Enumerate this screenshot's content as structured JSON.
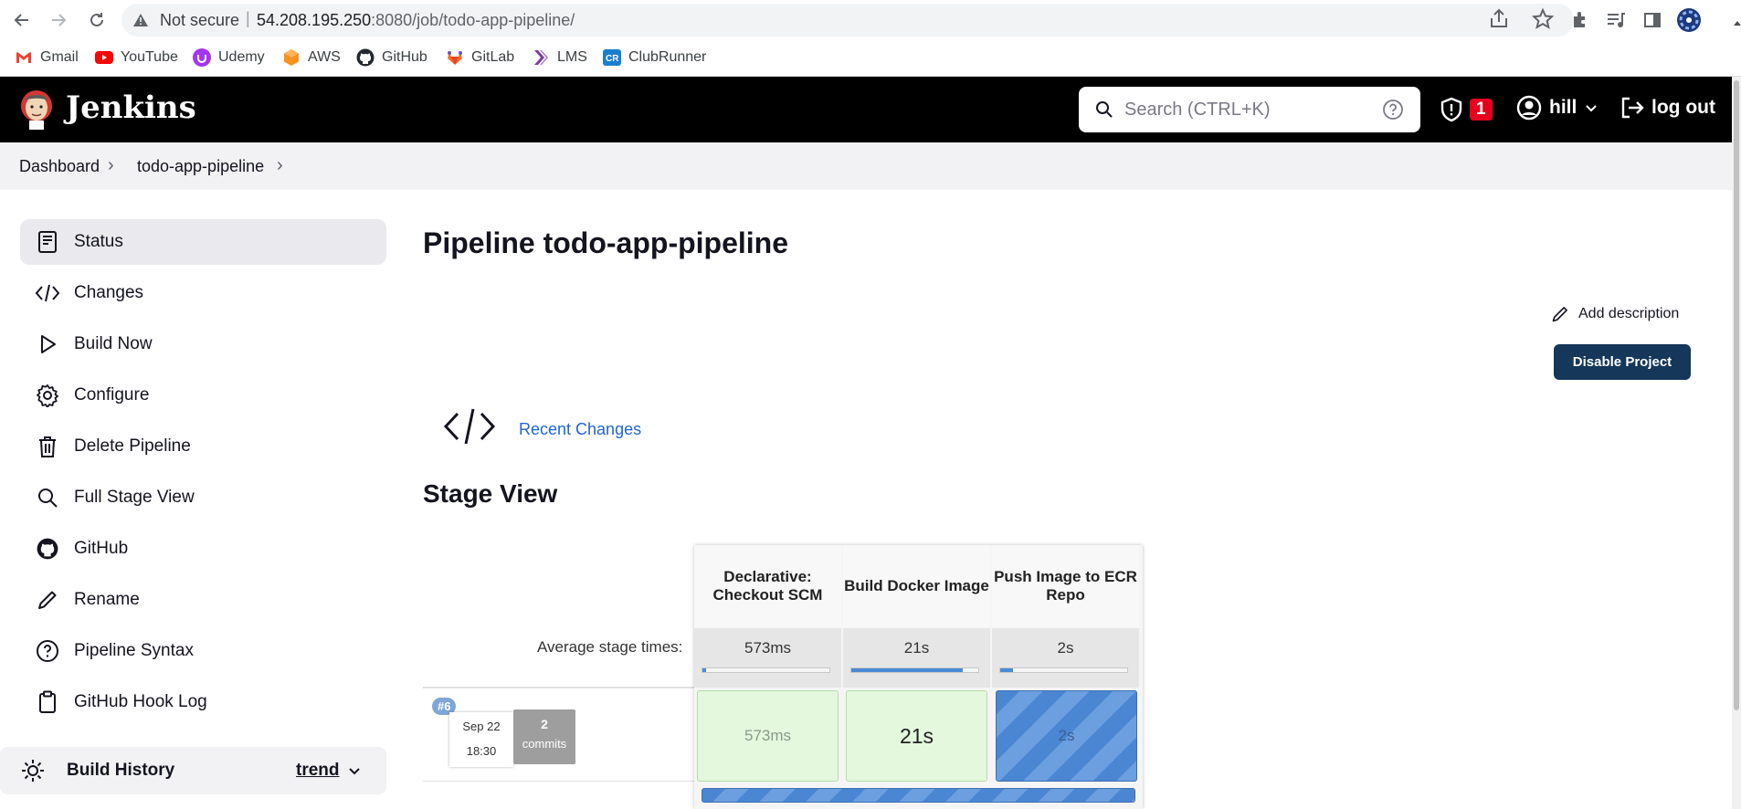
{
  "browser": {
    "security_label": "Not secure",
    "separator": "|",
    "url_host": "54.208.195.250",
    "url_rest": ":8080/job/todo-app-pipeline/"
  },
  "bookmarks": [
    {
      "label": "Gmail",
      "icon": "gmail-icon",
      "color": "#ea4335"
    },
    {
      "label": "YouTube",
      "icon": "youtube-icon",
      "color": "#ff0000"
    },
    {
      "label": "Udemy",
      "icon": "udemy-icon",
      "color": "#a435f0"
    },
    {
      "label": "AWS",
      "icon": "aws-icon",
      "color": "#f7931e"
    },
    {
      "label": "GitHub",
      "icon": "github-icon",
      "color": "#24292f"
    },
    {
      "label": "GitLab",
      "icon": "gitlab-icon",
      "color": "#fc6d26"
    },
    {
      "label": "LMS",
      "icon": "lms-icon",
      "color": "#7b3fa0"
    },
    {
      "label": "ClubRunner",
      "icon": "clubrunner-icon",
      "color": "#1a7fd1"
    }
  ],
  "header": {
    "app_name": "Jenkins",
    "search_placeholder": "Search (CTRL+K)",
    "security_count": "1",
    "user": "hill",
    "logout": "log out"
  },
  "breadcrumb": [
    "Dashboard",
    "todo-app-pipeline"
  ],
  "sidebar": {
    "items": [
      {
        "label": "Status",
        "icon": "status-icon"
      },
      {
        "label": "Changes",
        "icon": "code-icon"
      },
      {
        "label": "Build Now",
        "icon": "play-icon"
      },
      {
        "label": "Configure",
        "icon": "gear-icon"
      },
      {
        "label": "Delete Pipeline",
        "icon": "trash-icon"
      },
      {
        "label": "Full Stage View",
        "icon": "search-icon"
      },
      {
        "label": "GitHub",
        "icon": "github-icon"
      },
      {
        "label": "Rename",
        "icon": "pencil-icon"
      },
      {
        "label": "Pipeline Syntax",
        "icon": "help-icon"
      },
      {
        "label": "GitHub Hook Log",
        "icon": "clipboard-icon"
      }
    ],
    "build_history": {
      "label": "Build History",
      "trend": "trend"
    }
  },
  "main": {
    "title": "Pipeline todo-app-pipeline",
    "add_description": "Add description",
    "disable_button": "Disable Project",
    "recent_changes": "Recent Changes",
    "stage_view_title": "Stage View"
  },
  "stage_view": {
    "avg_label": "Average stage times:",
    "stages": [
      {
        "name": "Declarative: Checkout SCM",
        "avg": "573ms",
        "avg_fraction": 0.03
      },
      {
        "name": "Build Docker Image",
        "avg": "21s",
        "avg_fraction": 0.88
      },
      {
        "name": "Push Image to ECR Repo",
        "avg": "2s",
        "avg_fraction": 0.1
      }
    ],
    "run": {
      "badge": "#6",
      "date": "Sep 22",
      "time": "18:30",
      "commits_count": "2",
      "commits_label": "commits",
      "cells": [
        "573ms",
        "21s",
        "2s"
      ]
    }
  },
  "colors": {
    "header_bg": "#000000",
    "button_bg": "#14375a",
    "link": "#1f66d1",
    "success_bg": "#e3f8dc",
    "running": "#4a86d2"
  }
}
